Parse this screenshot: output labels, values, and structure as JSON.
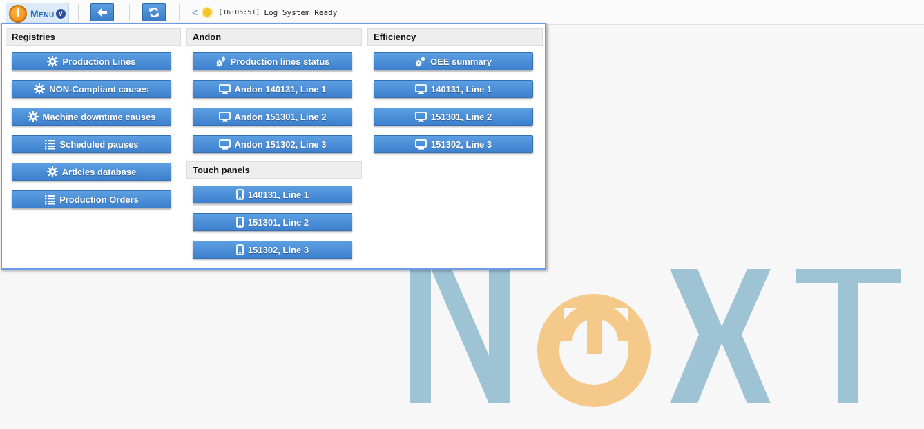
{
  "toolbar": {
    "menu_label": "Menu",
    "menu_caret": "V",
    "back_icon": "arrow-left-icon",
    "refresh_icon": "refresh-icon"
  },
  "log": {
    "back_glyph": "<",
    "time": "[16:06:51]",
    "message": "Log System Ready"
  },
  "menu": {
    "registries": {
      "title": "Registries",
      "items": [
        {
          "label": "Production Lines",
          "icon": "gear-icon"
        },
        {
          "label": "NON-Compliant causes",
          "icon": "gear-icon"
        },
        {
          "label": "Machine downtime causes",
          "icon": "gear-icon"
        },
        {
          "label": "Scheduled pauses",
          "icon": "list-icon"
        },
        {
          "label": "Articles database",
          "icon": "gear-icon"
        },
        {
          "label": "Production Orders",
          "icon": "list-icon"
        }
      ]
    },
    "andon": {
      "title": "Andon",
      "items": [
        {
          "label": "Production lines status",
          "icon": "gears-icon"
        },
        {
          "label": "Andon 140131, Line 1",
          "icon": "monitor-icon"
        },
        {
          "label": "Andon 151301, Line 2",
          "icon": "monitor-icon"
        },
        {
          "label": "Andon 151302, Line 3",
          "icon": "monitor-icon"
        }
      ]
    },
    "touch_panels": {
      "title": "Touch panels",
      "items": [
        {
          "label": "140131, Line 1",
          "icon": "mobile-icon"
        },
        {
          "label": "151301, Line 2",
          "icon": "mobile-icon"
        },
        {
          "label": "151302, Line 3",
          "icon": "mobile-icon"
        }
      ]
    },
    "efficiency": {
      "title": "Efficiency",
      "items": [
        {
          "label": "OEE summary",
          "icon": "gears-icon"
        },
        {
          "label": "140131, Line 1",
          "icon": "monitor-icon"
        },
        {
          "label": "151301, Line 2",
          "icon": "monitor-icon"
        },
        {
          "label": "151302, Line 3",
          "icon": "monitor-icon"
        }
      ]
    }
  },
  "watermark": {
    "text": "NeXT",
    "logo": "next-logo"
  },
  "colors": {
    "button": "#4a8ed8",
    "panel_border": "#6d9be6",
    "watermark_blue": "#9dc3d4",
    "watermark_orange": "#f5c98a"
  }
}
